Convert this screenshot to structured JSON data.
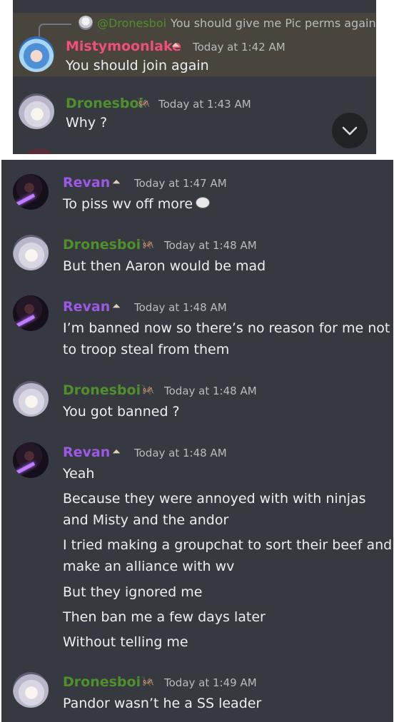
{
  "reply": {
    "author": "@Dronesboi",
    "text": "You should give me Pic perms again",
    "avatar_icon": "dronesboi-avatar-icon"
  },
  "messages_top": [
    {
      "author": "Mistymoonlake",
      "badge": "hat-icon",
      "time": "Today at 1:42 AM",
      "lines": [
        "You should join again"
      ]
    },
    {
      "author": "Dronesboi",
      "badge": "mantis-icon",
      "time": "Today at 1:43 AM",
      "lines": [
        "Why ?"
      ]
    }
  ],
  "messages_bottom": [
    {
      "author": "Revan",
      "badge": "hat-icon",
      "time": "Today at 1:47 AM",
      "lines": [
        "To piss wv off more"
      ],
      "emoji": "trollface-emoji"
    },
    {
      "author": "Dronesboi",
      "badge": "mantis-icon",
      "time": "Today at 1:48 AM",
      "lines": [
        "But then Aaron would be mad"
      ]
    },
    {
      "author": "Revan",
      "badge": "hat-icon",
      "time": "Today at 1:48 AM",
      "lines": [
        "I’m banned now so there’s no reason for me not",
        "to troop steal from them"
      ]
    },
    {
      "author": "Dronesboi",
      "badge": "mantis-icon",
      "time": "Today at 1:48 AM",
      "lines": [
        "You got banned ?"
      ]
    },
    {
      "author": "Revan",
      "badge": "hat-icon",
      "time": "Today at 1:48 AM",
      "lines": [
        "Yeah",
        "Because they were annoyed with with ninjas",
        "and Misty and the andor",
        "I tried making a groupchat to sort their beef and",
        "make an alliance with wv",
        "But they ignored me",
        "Then ban me a few days later",
        "Without telling me"
      ]
    },
    {
      "author": "Dronesboi",
      "badge": "mantis-icon",
      "time": "Today at 1:49 AM",
      "lines": [
        "Pandor wasn’t he a SS leader"
      ]
    }
  ],
  "colors": {
    "panel_bg": "#36393f",
    "highlight_bg": "#49443c",
    "misty": "#f04f7a",
    "dronesboi": "#4f8f2c",
    "revan": "#9b59e6"
  },
  "scroll_button_icon": "chevron-down-icon"
}
